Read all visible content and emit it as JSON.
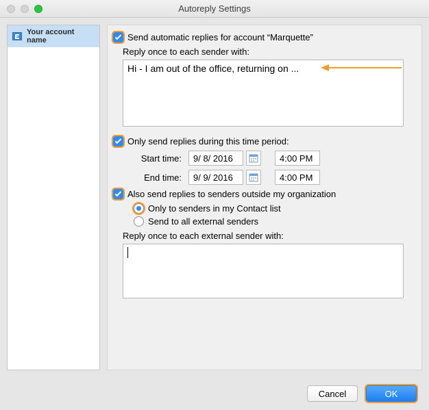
{
  "window": {
    "title": "Autoreply Settings"
  },
  "sidebar": {
    "account_name": "Your account name"
  },
  "main": {
    "send_auto_label": "Send automatic replies for account “Marquette”",
    "reply_label": "Reply once to each sender with:",
    "reply_body": "Hi - I am out of the office, returning on ...",
    "time_checkbox_label": "Only send replies during this time period:",
    "start_label": "Start time:",
    "start_date": "9/ 8/ 2016",
    "start_time": "4:00 PM",
    "end_label": "End time:",
    "end_date": "9/ 9/ 2016",
    "end_time": "4:00 PM",
    "outside_label": "Also send replies to senders outside my organization",
    "radio_contacts": "Only to senders in my Contact list",
    "radio_all": "Send to all external senders",
    "external_reply_label": "Reply once to each external sender with:",
    "external_reply_body": ""
  },
  "footer": {
    "cancel": "Cancel",
    "ok": "OK"
  },
  "colors": {
    "highlight": "#f39c28",
    "accent": "#2f8af2"
  }
}
